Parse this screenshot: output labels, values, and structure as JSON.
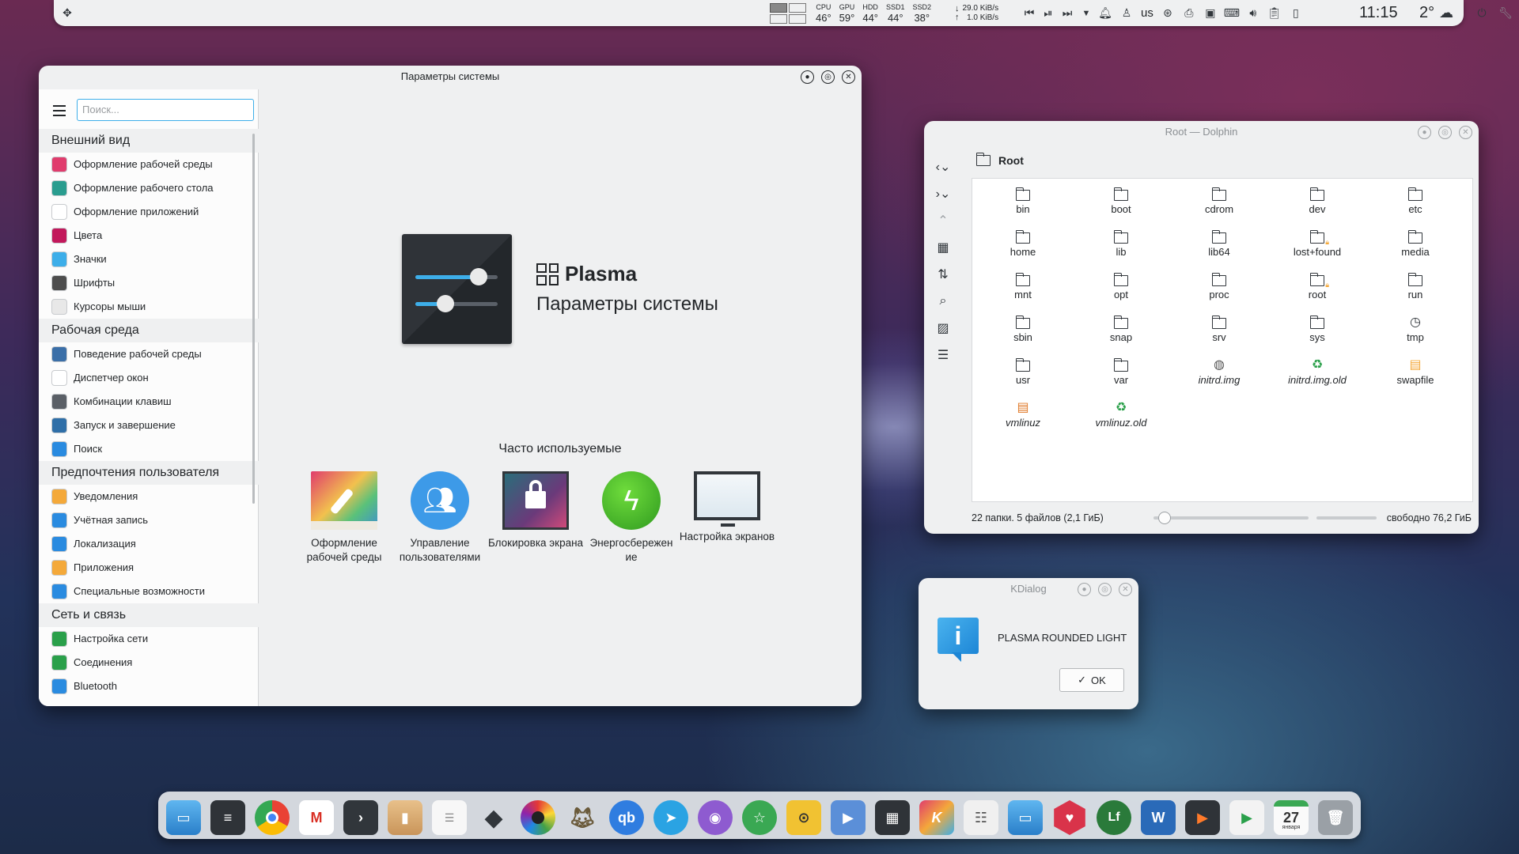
{
  "panel": {
    "cpu_label": "CPU",
    "cpu_val": "46°",
    "gpu_label": "GPU",
    "gpu_val": "59°",
    "hdd_label": "HDD",
    "hdd_val": "44°",
    "ssd1_label": "SSD1",
    "ssd1_val": "44°",
    "ssd2_label": "SSD2",
    "ssd2_val": "38°",
    "net_down": "29.0 KiB/s",
    "net_up": "1.0 KiB/s",
    "keyboard_layout": "us",
    "clock": "11:15",
    "weather_temp": "2°"
  },
  "settings": {
    "title": "Параметры системы",
    "search_placeholder": "Поиск...",
    "categories": [
      {
        "label": "Внешний вид",
        "items": [
          {
            "label": "Оформление рабочей среды",
            "icon": "global-theme-icon",
            "color": "#e03c6d"
          },
          {
            "label": "Оформление рабочего стола",
            "icon": "plasma-style-icon",
            "color": "#2a9d8f"
          },
          {
            "label": "Оформление приложений",
            "icon": "app-style-icon",
            "color": "#ffffff"
          },
          {
            "label": "Цвета",
            "icon": "colors-icon",
            "color": "#c2185b"
          },
          {
            "label": "Значки",
            "icon": "icons-icon",
            "color": "#3daee9"
          },
          {
            "label": "Шрифты",
            "icon": "fonts-icon",
            "color": "#4d4d4d"
          },
          {
            "label": "Курсоры мыши",
            "icon": "cursor-icon",
            "color": "#e8e8e8"
          }
        ]
      },
      {
        "label": "Рабочая среда",
        "items": [
          {
            "label": "Поведение рабочей среды",
            "icon": "workspace-behavior-icon",
            "color": "#3b6fa8"
          },
          {
            "label": "Диспетчер окон",
            "icon": "window-manager-icon",
            "color": "#ffffff"
          },
          {
            "label": "Комбинации клавиш",
            "icon": "shortcuts-icon",
            "color": "#5a5f66"
          },
          {
            "label": "Запуск и завершение",
            "icon": "startup-icon",
            "color": "#2f6fa8"
          },
          {
            "label": "Поиск",
            "icon": "search-settings-icon",
            "color": "#2a8be0"
          }
        ]
      },
      {
        "label": "Предпочтения пользователя",
        "items": [
          {
            "label": "Уведомления",
            "icon": "bell-icon",
            "color": "#f4a93a"
          },
          {
            "label": "Учётная запись",
            "icon": "account-icon",
            "color": "#2a8be0"
          },
          {
            "label": "Локализация",
            "icon": "localization-icon",
            "color": "#2a8be0"
          },
          {
            "label": "Приложения",
            "icon": "star-icon",
            "color": "#f4a93a"
          },
          {
            "label": "Специальные возможности",
            "icon": "accessibility-icon",
            "color": "#2a8be0"
          }
        ]
      },
      {
        "label": "Сеть и связь",
        "items": [
          {
            "label": "Настройка сети",
            "icon": "network-icon",
            "color": "#2aa04a"
          },
          {
            "label": "Соединения",
            "icon": "connections-icon",
            "color": "#2aa04a"
          },
          {
            "label": "Bluetooth",
            "icon": "bluetooth-icon",
            "color": "#2a8be0"
          }
        ]
      }
    ],
    "brand": "Plasma",
    "subtitle": "Параметры системы",
    "frequent_title": "Часто используемые",
    "frequent": [
      {
        "label": "Оформление рабочей среды"
      },
      {
        "label": "Управление пользователями"
      },
      {
        "label": "Блокировка экрана"
      },
      {
        "label": "Энергосбережен ие"
      },
      {
        "label": "Настройка экранов"
      }
    ]
  },
  "dolphin": {
    "title": "Root — Dolphin",
    "location": "Root",
    "files": [
      {
        "name": "bin",
        "kind": "folder"
      },
      {
        "name": "boot",
        "kind": "folder"
      },
      {
        "name": "cdrom",
        "kind": "folder"
      },
      {
        "name": "dev",
        "kind": "folder"
      },
      {
        "name": "etc",
        "kind": "folder"
      },
      {
        "name": "home",
        "kind": "folder"
      },
      {
        "name": "lib",
        "kind": "folder"
      },
      {
        "name": "lib64",
        "kind": "folder"
      },
      {
        "name": "lost+found",
        "kind": "locked-folder"
      },
      {
        "name": "media",
        "kind": "folder"
      },
      {
        "name": "mnt",
        "kind": "folder"
      },
      {
        "name": "opt",
        "kind": "folder"
      },
      {
        "name": "proc",
        "kind": "folder"
      },
      {
        "name": "root",
        "kind": "locked-folder"
      },
      {
        "name": "run",
        "kind": "folder"
      },
      {
        "name": "sbin",
        "kind": "folder"
      },
      {
        "name": "snap",
        "kind": "folder"
      },
      {
        "name": "srv",
        "kind": "folder"
      },
      {
        "name": "sys",
        "kind": "folder"
      },
      {
        "name": "tmp",
        "kind": "clock"
      },
      {
        "name": "usr",
        "kind": "folder"
      },
      {
        "name": "var",
        "kind": "folder"
      },
      {
        "name": "initrd.img",
        "kind": "link"
      },
      {
        "name": "initrd.img.old",
        "kind": "recycle-link"
      },
      {
        "name": "swapfile",
        "kind": "locked-file"
      },
      {
        "name": "vmlinuz",
        "kind": "locked-link"
      },
      {
        "name": "vmlinuz.old",
        "kind": "recycle-link"
      }
    ],
    "status_text": "22 папки. 5 файлов (2,1 ГиБ)",
    "free_text": "свободно 76,2 ГиБ"
  },
  "kdialog": {
    "title": "KDialog",
    "message": "PLASMA ROUNDED LIGHT",
    "ok_label": "OK"
  },
  "calendar": {
    "day": "27",
    "month": "января"
  },
  "colors": {
    "accent": "#3daee9",
    "window_bg": "#eff0f1",
    "text": "#232629"
  }
}
